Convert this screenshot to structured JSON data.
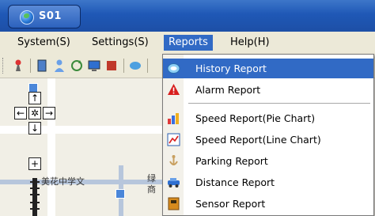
{
  "window": {
    "title": "S01"
  },
  "menubar": {
    "items": [
      {
        "label": "System(S)",
        "name": "menu-system"
      },
      {
        "label": "Settings(S)",
        "name": "menu-settings"
      },
      {
        "label": "Reports",
        "name": "menu-reports"
      },
      {
        "label": "Help(H)",
        "name": "menu-help"
      }
    ]
  },
  "map": {
    "labels": [
      "美花中学文",
      "绿",
      "商"
    ],
    "nav": {
      "up": "↑",
      "left": "←",
      "center": "✲",
      "right": "→",
      "down": "↓",
      "zoom_in": "+"
    }
  },
  "reports_menu": {
    "items": [
      {
        "label": "History Report",
        "icon": "history-icon"
      },
      {
        "label": "Alarm Report",
        "icon": "alarm-icon"
      },
      {
        "label": "Speed Report(Pie Chart)",
        "icon": "pie-chart-icon"
      },
      {
        "label": "Speed Report(Line Chart)",
        "icon": "line-chart-icon"
      },
      {
        "label": "Parking Report",
        "icon": "parking-icon"
      },
      {
        "label": "Distance Report",
        "icon": "distance-icon"
      },
      {
        "label": "Sensor Report",
        "icon": "sensor-icon"
      }
    ]
  },
  "colors": {
    "highlight": "#316ac5",
    "titlebar": "#1f58b6"
  }
}
